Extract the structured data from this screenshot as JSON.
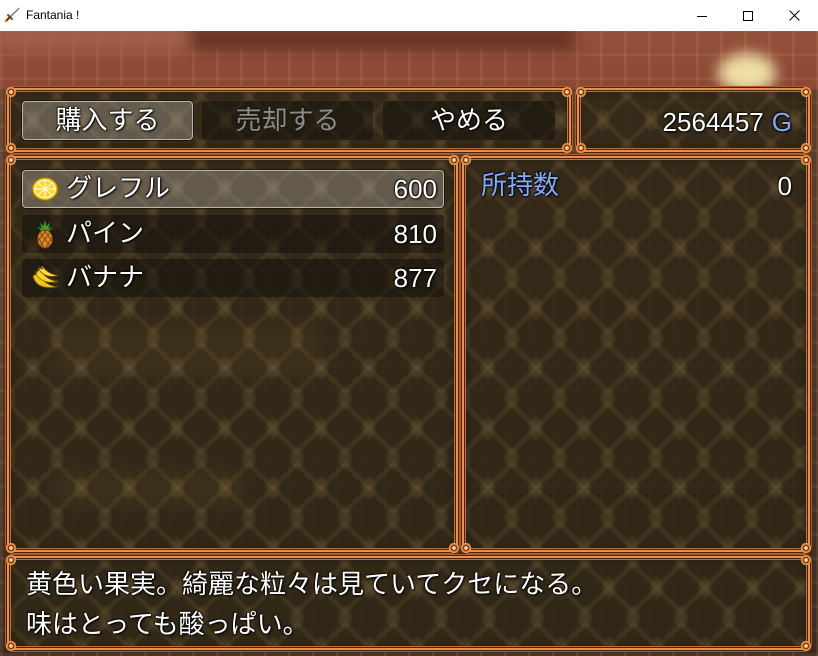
{
  "window": {
    "title": "Fantania !",
    "app_icon": "sword-icon",
    "control_icons": [
      "minimize-icon",
      "maximize-icon",
      "close-icon"
    ]
  },
  "shop": {
    "commands": [
      {
        "label": "購入する",
        "selected": true,
        "disabled": false
      },
      {
        "label": "売却する",
        "selected": false,
        "disabled": true
      },
      {
        "label": "やめる",
        "selected": false,
        "disabled": false
      }
    ],
    "gold": {
      "amount": 2564457,
      "unit": "G"
    },
    "items": [
      {
        "icon": "grapefruit-icon",
        "name": "グレフル",
        "price": 600,
        "selected": true
      },
      {
        "icon": "pineapple-icon",
        "name": "パイン",
        "price": 810,
        "selected": false
      },
      {
        "icon": "banana-icon",
        "name": "バナナ",
        "price": 877,
        "selected": false
      }
    ],
    "possession": {
      "label": "所持数",
      "count": 0
    },
    "help_lines": [
      "黄色い果実。綺麗な粒々は見ていてクセになる。",
      "味はとっても酸っぱい。"
    ]
  },
  "colors": {
    "text": "#ffffff",
    "system": "#84aaff",
    "disabled": "#8c8c8c",
    "frame": "#e8914c",
    "titlebar": "#ffffff"
  }
}
